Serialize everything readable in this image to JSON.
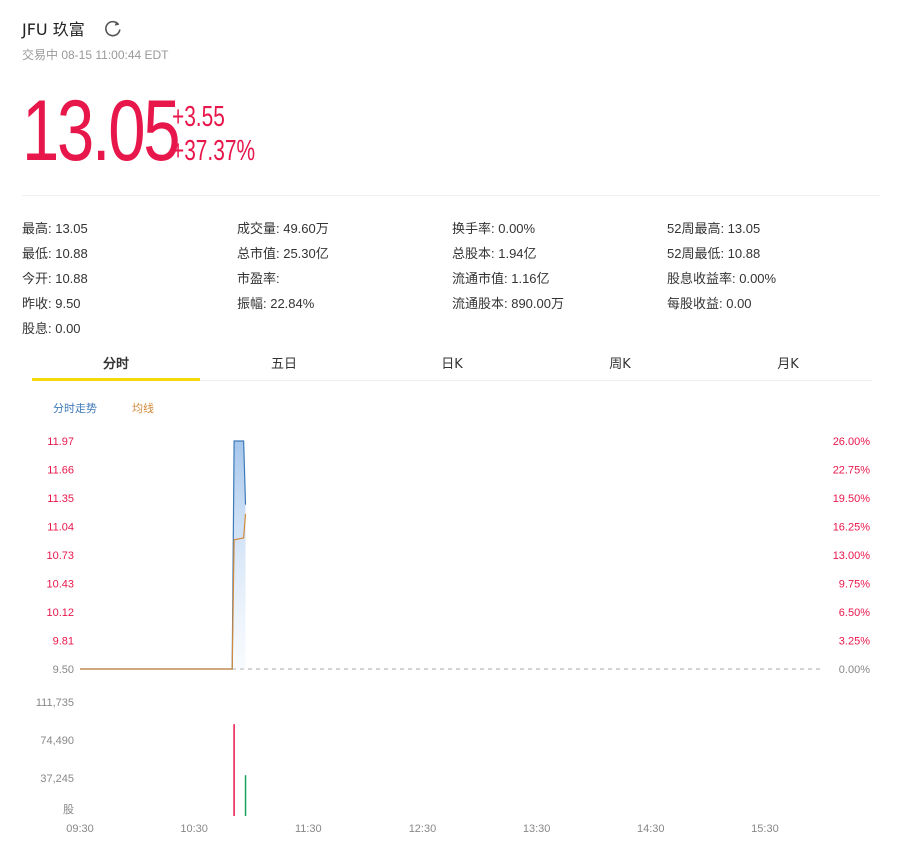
{
  "header": {
    "title": "JFU 玖富",
    "status": "交易中 08-15 11:00:44 EDT"
  },
  "quote": {
    "price": "13.05",
    "change": "+3.55",
    "change_pct": "+37.37%"
  },
  "stats": [
    [
      "最高: 13.05",
      "成交量: 49.60万",
      "换手率: 0.00%",
      "52周最高: 13.05"
    ],
    [
      "最低: 10.88",
      "总市值: 25.30亿",
      "总股本: 1.94亿",
      "52周最低: 10.88"
    ],
    [
      "今开: 10.88",
      "市盈率:",
      "流通市值: 1.16亿",
      "股息收益率: 0.00%"
    ],
    [
      "昨收: 9.50",
      "振幅: 22.84%",
      "流通股本: 890.00万",
      "每股收益: 0.00"
    ],
    [
      "股息: 0.00"
    ]
  ],
  "tabs": [
    "分时",
    "五日",
    "日K",
    "周K",
    "月K"
  ],
  "active_tab": 0,
  "legend": {
    "price_series": "分时走势",
    "avg_series": "均线"
  },
  "colors": {
    "up": "#e8174b",
    "price_line": "#3e7ab8",
    "avg_line": "#d08a3b",
    "tab_underline": "#f5d90a",
    "vol_down": "#1aa260"
  },
  "chart_data": {
    "type": "line",
    "x_ticks": [
      "09:30",
      "10:30",
      "11:30",
      "12:30",
      "13:30",
      "14:30",
      "15:30"
    ],
    "y_left_ticks": [
      "11.97",
      "11.66",
      "11.35",
      "11.04",
      "10.73",
      "10.43",
      "10.12",
      "9.81",
      "9.50"
    ],
    "y_right_ticks": [
      "26.00%",
      "22.75%",
      "19.50%",
      "16.25%",
      "13.00%",
      "9.75%",
      "6.50%",
      "3.25%",
      "0.00%"
    ],
    "ylim": [
      9.5,
      11.97
    ],
    "prev_close": 9.5,
    "series": [
      {
        "name": "分时走势",
        "points": [
          [
            "09:30",
            9.5
          ],
          [
            "10:50",
            9.5
          ],
          [
            "10:51",
            11.97
          ],
          [
            "10:52",
            11.97
          ],
          [
            "10:56",
            11.97
          ],
          [
            "10:57",
            11.28
          ]
        ]
      },
      {
        "name": "均线",
        "points": [
          [
            "09:30",
            9.5
          ],
          [
            "10:50",
            9.5
          ],
          [
            "10:51",
            10.9
          ],
          [
            "10:56",
            10.92
          ],
          [
            "10:57",
            11.18
          ]
        ]
      }
    ],
    "volume": {
      "unit": "股",
      "ticks": [
        "111,735",
        "74,490",
        "37,245"
      ],
      "ymax": 111735,
      "bars": [
        {
          "time": "10:51",
          "value": 90000,
          "direction": "up"
        },
        {
          "time": "10:57",
          "value": 40000,
          "direction": "down"
        }
      ]
    }
  }
}
